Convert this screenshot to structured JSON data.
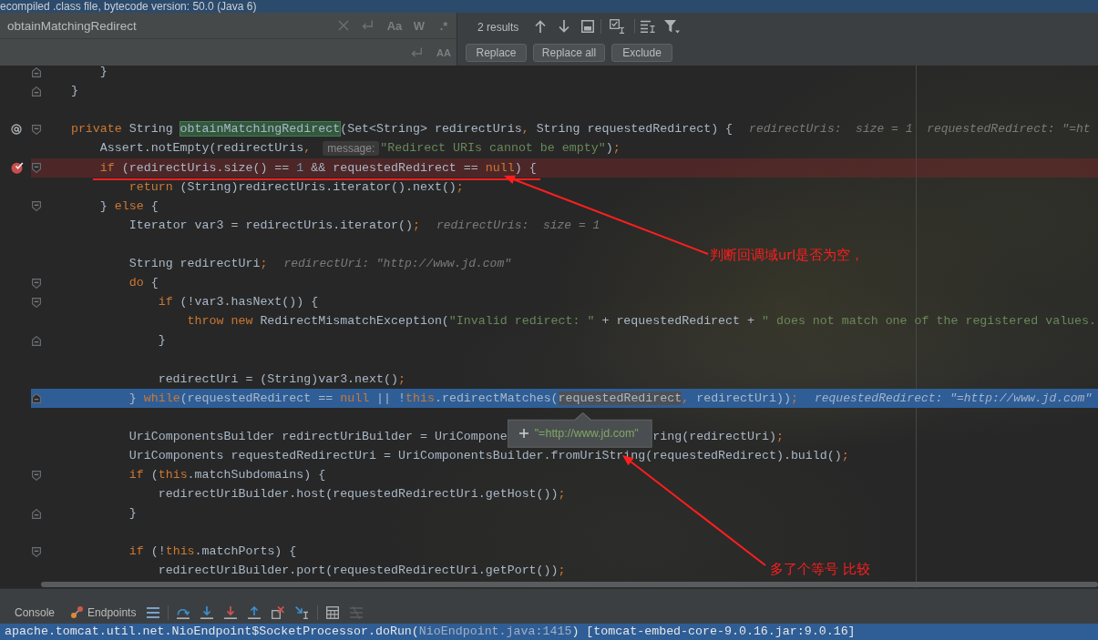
{
  "notification_bar": {
    "text": "ecompiled .class file, bytecode version: 50.0 (Java 6)"
  },
  "find_bar": {
    "search_value": "obtainMatchingRedirect",
    "search_options": [
      {
        "label": "Aa",
        "selected": false
      },
      {
        "label": "W",
        "selected": false
      },
      {
        "label": ".*",
        "selected": false
      }
    ],
    "replace_options": [
      {
        "label": "AA",
        "selected": false
      }
    ],
    "result_count": "2 results",
    "buttons": [
      "Replace",
      "Replace all",
      "Exclude"
    ]
  },
  "editor": {
    "lines": [
      {
        "children": [
          {
            "close": {
              "line": {
                "kind": "code",
                "fold_end": true,
                "parts": [
                  {
                    "kind": "code",
                    "tokens": [
                      {
                        "kind": "plain",
                        "text": "}"
                      }
                    ]
                  }
                ]
              }
            }
          }
        ],
        "close": {
          "line": {
            "kind": "code",
            "fold_end": true,
            "parts": [
              {
                "kind": "code",
                "tokens": [
                  {
                    "kind": "plain",
                    "text": "}"
                  }
                ]
              }
            ]
          }
        }
      },
      {
        "line": {
          "kind": "blank"
        }
      },
      {
        "line": {
          "kind": "code",
          "annotated": true,
          "fold_start": true,
          "parts": [
            {
              "kind": "code",
              "tokens": [
                {
                  "kind": "keyword",
                  "text": "private"
                },
                {
                  "kind": "plain",
                  "text": " String "
                },
                {
                  "kind": "match",
                  "text": "obtainMatchingRedirect"
                },
                {
                  "kind": "plain",
                  "text": "(Set<String> redirectUris"
                },
                {
                  "kind": "keyword",
                  "text": ","
                },
                {
                  "kind": "plain",
                  "text": " String requestedRedirect) {"
                }
              ]
            },
            {
              "kind": "inline_value",
              "text": "redirectUris:  size = 1  requestedRedirect: \"=ht"
            }
          ]
        },
        "children": [
          {
            "line": {
              "kind": "code",
              "parts": [
                {
                  "kind": "code",
                  "tokens": [
                    {
                      "kind": "plain",
                      "text": "Assert.notEmpty(redirectUris"
                    },
                    {
                      "kind": "keyword",
                      "text": ","
                    }
                  ]
                },
                {
                  "kind": "param_hint",
                  "text": "message:"
                },
                {
                  "kind": "code",
                  "tokens": [
                    {
                      "kind": "string",
                      "text": "\"Redirect URIs cannot be empty\""
                    },
                    {
                      "kind": "plain",
                      "text": ")"
                    },
                    {
                      "kind": "keyword",
                      "text": ";"
                    }
                  ]
                }
              ]
            }
          },
          {
            "line": {
              "kind": "code",
              "breakpoint": true,
              "fold_start": true,
              "parts": [
                {
                  "kind": "code",
                  "tokens": [
                    {
                      "kind": "keyword",
                      "text": "if"
                    },
                    {
                      "kind": "plain",
                      "text": " (redirectUris.size() == "
                    },
                    {
                      "kind": "number",
                      "text": "1"
                    },
                    {
                      "kind": "plain",
                      "text": " && requestedRedirect == "
                    },
                    {
                      "kind": "keyword",
                      "text": "null"
                    },
                    {
                      "kind": "plain",
                      "text": ") {"
                    }
                  ]
                }
              ]
            },
            "children": [
              {
                "line": {
                  "kind": "code",
                  "parts": [
                    {
                      "kind": "code",
                      "tokens": [
                        {
                          "kind": "keyword",
                          "text": "return"
                        },
                        {
                          "kind": "plain",
                          "text": " (String)redirectUris.iterator().next()"
                        },
                        {
                          "kind": "keyword",
                          "text": ";"
                        }
                      ]
                    }
                  ]
                }
              }
            ],
            "close": {
              "line": {
                "kind": "code",
                "fold_start": true,
                "parts": [
                  {
                    "kind": "code",
                    "tokens": [
                      {
                        "kind": "plain",
                        "text": "} "
                      },
                      {
                        "kind": "keyword",
                        "text": "else"
                      },
                      {
                        "kind": "plain",
                        "text": " {"
                      }
                    ]
                  }
                ]
              },
              "children": [
                {
                  "line": {
                    "kind": "code",
                    "parts": [
                      {
                        "kind": "code",
                        "tokens": [
                          {
                            "kind": "plain",
                            "text": "Iterator var3 = redirectUris.iterator()"
                          },
                          {
                            "kind": "keyword",
                            "text": ";"
                          }
                        ]
                      },
                      {
                        "kind": "inline_value",
                        "text": "redirectUris:  size = 1"
                      }
                    ]
                  }
                },
                {
                  "line": {
                    "kind": "blank"
                  }
                },
                {
                  "line": {
                    "kind": "code",
                    "parts": [
                      {
                        "kind": "code",
                        "tokens": [
                          {
                            "kind": "plain",
                            "text": "String redirectUri"
                          },
                          {
                            "kind": "keyword",
                            "text": ";"
                          }
                        ]
                      },
                      {
                        "kind": "inline_value",
                        "text": "redirectUri: \"http://www.jd.com\""
                      }
                    ]
                  }
                },
                {
                  "line": {
                    "kind": "code",
                    "fold_start": true,
                    "parts": [
                      {
                        "kind": "code",
                        "tokens": [
                          {
                            "kind": "keyword",
                            "text": "do"
                          },
                          {
                            "kind": "plain",
                            "text": " {"
                          }
                        ]
                      }
                    ]
                  },
                  "children": [
                    {
                      "line": {
                        "kind": "code",
                        "fold_start": true,
                        "parts": [
                          {
                            "kind": "code",
                            "tokens": [
                              {
                                "kind": "keyword",
                                "text": "if"
                              },
                              {
                                "kind": "plain",
                                "text": " (!var3.hasNext()) {"
                              }
                            ]
                          }
                        ]
                      },
                      "children": [
                        {
                          "line": {
                            "kind": "code",
                            "parts": [
                              {
                                "kind": "code",
                                "tokens": [
                                  {
                                    "kind": "keyword",
                                    "text": "throw new"
                                  },
                                  {
                                    "kind": "plain",
                                    "text": " RedirectMismatchException("
                                  },
                                  {
                                    "kind": "string",
                                    "text": "\"Invalid redirect: \""
                                  },
                                  {
                                    "kind": "plain",
                                    "text": " + requestedRedirect + "
                                  },
                                  {
                                    "kind": "string",
                                    "text": "\" does not match one of the registered values."
                                  }
                                ]
                              }
                            ]
                          }
                        }
                      ],
                      "close": {
                        "line": {
                          "kind": "code",
                          "fold_end": true,
                          "parts": [
                            {
                              "kind": "code",
                              "tokens": [
                                {
                                  "kind": "plain",
                                  "text": "}"
                                }
                              ]
                            }
                          ]
                        }
                      }
                    },
                    {
                      "line": {
                        "kind": "blank"
                      }
                    },
                    {
                      "line": {
                        "kind": "code",
                        "parts": [
                          {
                            "kind": "code",
                            "tokens": [
                              {
                                "kind": "plain",
                                "text": "redirectUri = (String)var3.next()"
                              },
                              {
                                "kind": "keyword",
                                "text": ";"
                              }
                            ]
                          }
                        ]
                      }
                    }
                  ],
                  "close": {
                    "line": {
                      "kind": "code",
                      "fold_end": true,
                      "execution_point": true,
                      "parts": [
                        {
                          "kind": "code",
                          "tokens": [
                            {
                              "kind": "plain",
                              "text": "} "
                            },
                            {
                              "kind": "keyword",
                              "text": "while"
                            },
                            {
                              "kind": "plain",
                              "text": "(requestedRedirect == "
                            },
                            {
                              "kind": "keyword",
                              "text": "null"
                            },
                            {
                              "kind": "plain",
                              "text": " || !"
                            },
                            {
                              "kind": "keyword",
                              "text": "this"
                            },
                            {
                              "kind": "plain",
                              "text": ".redirectMatches("
                            },
                            {
                              "kind": "hovered",
                              "text": "requestedRedirect"
                            },
                            {
                              "kind": "keyword",
                              "text": ","
                            },
                            {
                              "kind": "plain",
                              "text": " redirectUri))"
                            },
                            {
                              "kind": "keyword",
                              "text": ";"
                            }
                          ]
                        },
                        {
                          "kind": "inline_value",
                          "text": "requestedRedirect: \"=http://www.jd.com\""
                        }
                      ]
                    }
                  }
                },
                {
                  "line": {
                    "kind": "blank"
                  }
                },
                {
                  "line": {
                    "kind": "code",
                    "parts": [
                      {
                        "kind": "code",
                        "tokens": [
                          {
                            "kind": "plain",
                            "text": "UriComponentsBuilder redirectUriBuilder = UriCompone"
                          }
                        ]
                      },
                      {
                        "kind": "tooltip",
                        "text": "\"=http://www.jd.com\""
                      },
                      {
                        "kind": "code",
                        "tokens": [
                          {
                            "kind": "plain",
                            "text": "ring(redirectUri)"
                          },
                          {
                            "kind": "keyword",
                            "text": ";"
                          }
                        ]
                      }
                    ]
                  }
                },
                {
                  "line": {
                    "kind": "code",
                    "parts": [
                      {
                        "kind": "code",
                        "tokens": [
                          {
                            "kind": "plain",
                            "text": "UriComponents requestedRedirectUri = UriComponentsBuilder.fromUriString(requestedRedirect).build()"
                          },
                          {
                            "kind": "keyword",
                            "text": ";"
                          }
                        ]
                      }
                    ]
                  }
                },
                {
                  "line": {
                    "kind": "code",
                    "fold_start": true,
                    "parts": [
                      {
                        "kind": "code",
                        "tokens": [
                          {
                            "kind": "keyword",
                            "text": "if"
                          },
                          {
                            "kind": "plain",
                            "text": " ("
                          },
                          {
                            "kind": "keyword",
                            "text": "this"
                          },
                          {
                            "kind": "plain",
                            "text": ".matchSubdomains) {"
                          }
                        ]
                      }
                    ]
                  },
                  "children": [
                    {
                      "line": {
                        "kind": "code",
                        "parts": [
                          {
                            "kind": "code",
                            "tokens": [
                              {
                                "kind": "plain",
                                "text": "redirectUriBuilder.host(requestedRedirectUri.getHost())"
                              },
                              {
                                "kind": "keyword",
                                "text": ";"
                              }
                            ]
                          }
                        ]
                      }
                    }
                  ],
                  "close": {
                    "line": {
                      "kind": "code",
                      "fold_end": true,
                      "parts": [
                        {
                          "kind": "code",
                          "tokens": [
                            {
                              "kind": "plain",
                              "text": "}"
                            }
                          ]
                        }
                      ]
                    }
                  }
                },
                {
                  "line": {
                    "kind": "blank"
                  }
                },
                {
                  "line": {
                    "kind": "code",
                    "fold_start": true,
                    "parts": [
                      {
                        "kind": "code",
                        "tokens": [
                          {
                            "kind": "keyword",
                            "text": "if"
                          },
                          {
                            "kind": "plain",
                            "text": " (!"
                          },
                          {
                            "kind": "keyword",
                            "text": "this"
                          },
                          {
                            "kind": "plain",
                            "text": ".matchPorts) {"
                          }
                        ]
                      }
                    ]
                  },
                  "children": [
                    {
                      "line": {
                        "kind": "code",
                        "parts": [
                          {
                            "kind": "code",
                            "tokens": [
                              {
                                "kind": "plain",
                                "text": "redirectUriBuilder.port(requestedRedirectUri.getPort())"
                              },
                              {
                                "kind": "keyword",
                                "text": ";"
                              }
                            ]
                          }
                        ]
                      }
                    }
                  ]
                }
              ]
            }
          }
        ]
      }
    ]
  },
  "debug_panel": {
    "tabs": [
      {
        "label": "Console",
        "selected": false
      },
      {
        "label": "Endpoints",
        "selected": false
      }
    ],
    "output_line": {
      "selected": true,
      "parts": [
        {
          "kind": "plain",
          "text": "apache.tomcat.util.net.NioEndpoint$SocketProcessor.doRun("
        },
        {
          "kind": "location",
          "text": "NioEndpoint.java:1415"
        },
        {
          "kind": "plain",
          "text": ") [tomcat-embed-core-9.0.16.jar:9.0.16]"
        }
      ]
    }
  },
  "annotations": [
    {
      "kind": "underline"
    },
    {
      "kind": "arrow",
      "text": "判断回调域url是否为空，"
    },
    {
      "kind": "arrow",
      "text": "多了个等号 比较"
    }
  ]
}
